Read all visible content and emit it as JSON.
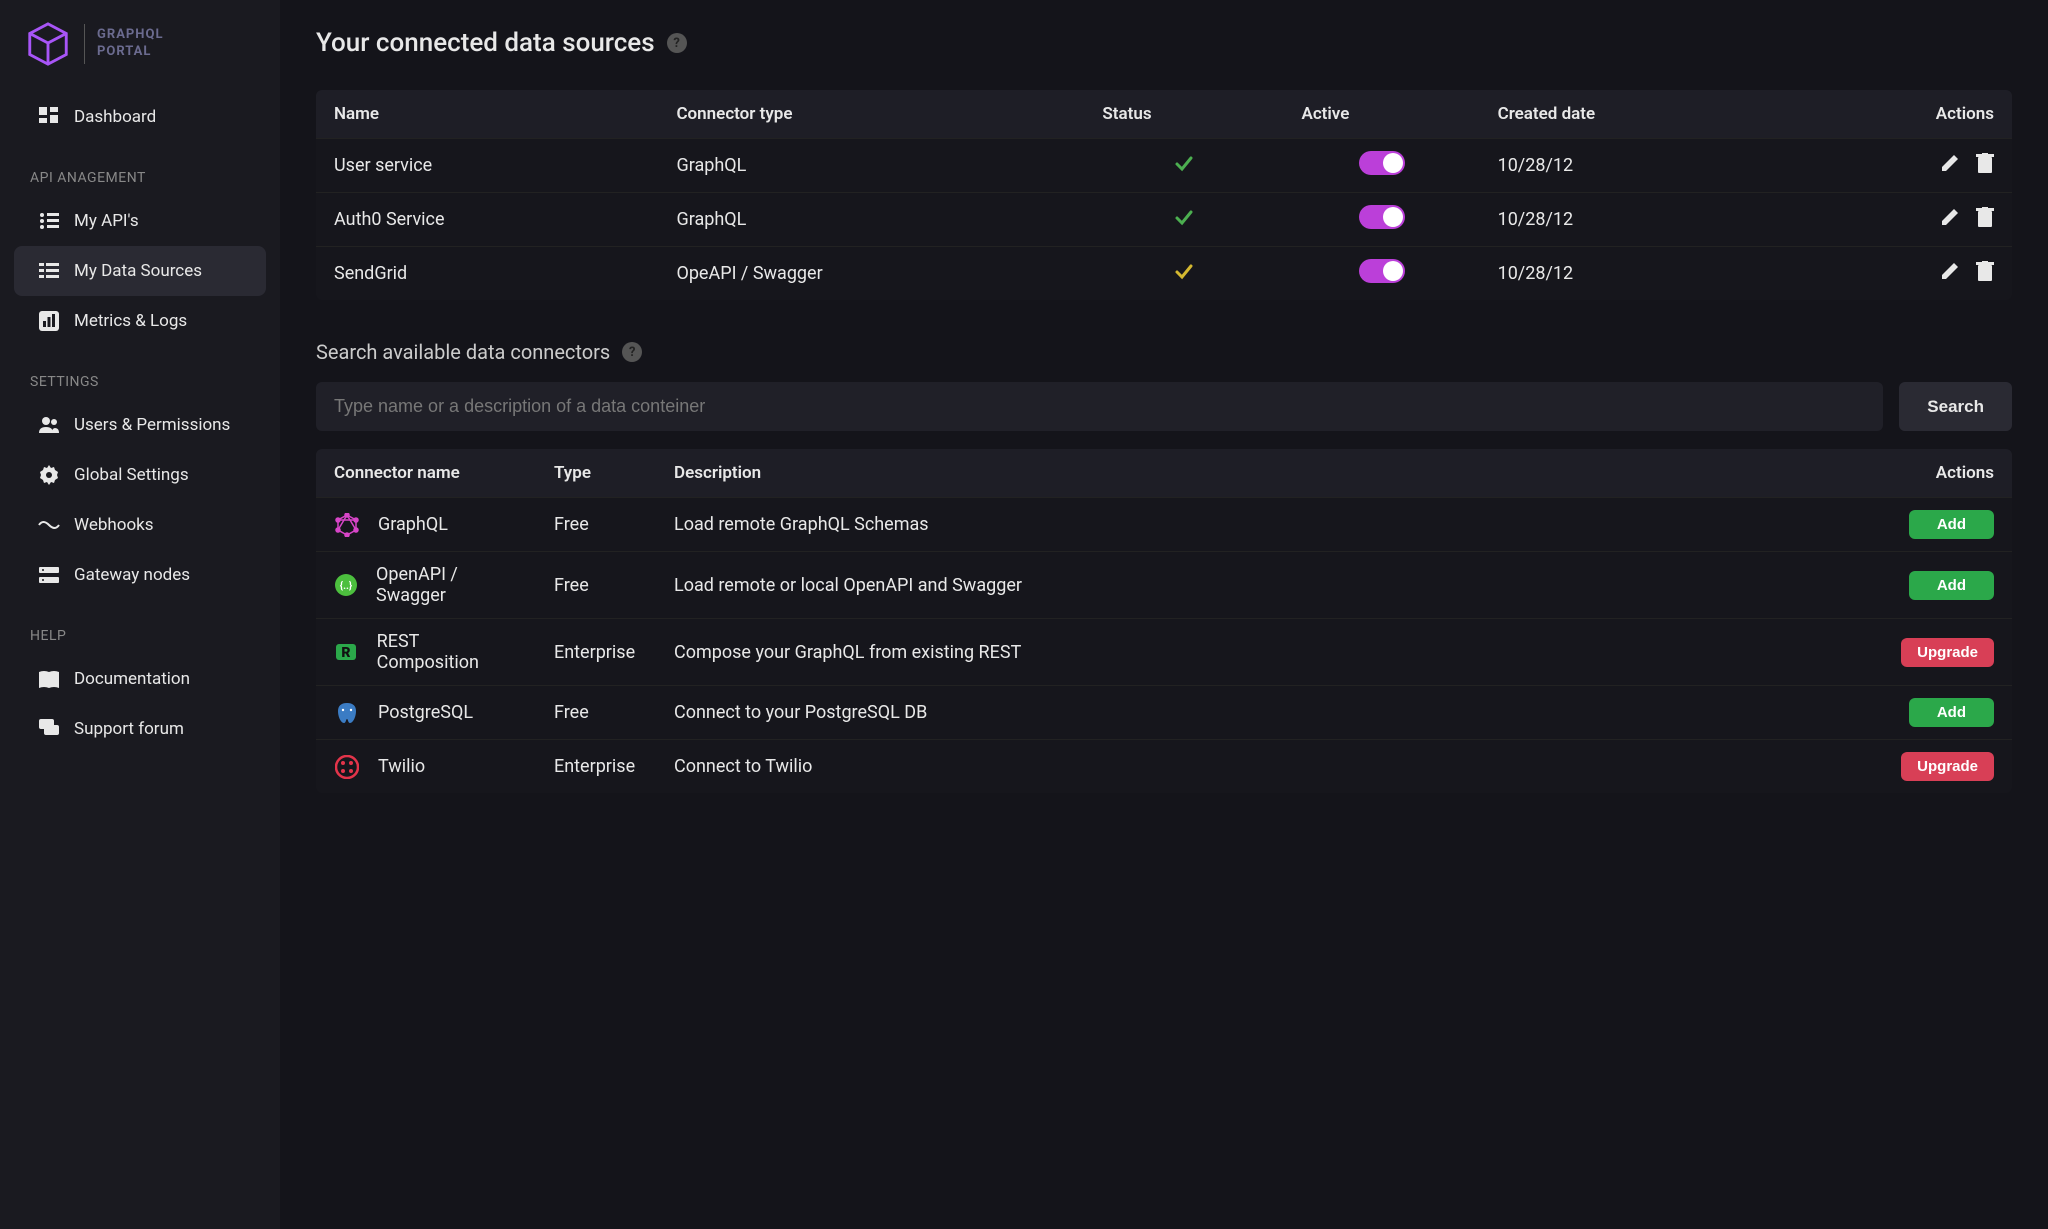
{
  "brand": {
    "line1": "GRAPHQL",
    "line2": "PORTAL"
  },
  "nav": {
    "dashboard": "Dashboard",
    "section_api": "API ANAGEMENT",
    "my_apis": "My API's",
    "my_data_sources": "My Data Sources",
    "metrics_logs": "Metrics & Logs",
    "section_settings": "SETTINGS",
    "users_permissions": "Users & Permissions",
    "global_settings": "Global Settings",
    "webhooks": "Webhooks",
    "gateway_nodes": "Gateway nodes",
    "section_help": "HELP",
    "documentation": "Documentation",
    "support_forum": "Support forum"
  },
  "page_title": "Your connected data sources",
  "connected_table": {
    "headers": {
      "name": "Name",
      "connector_type": "Connector type",
      "status": "Status",
      "active": "Active",
      "created": "Created date",
      "actions": "Actions"
    },
    "rows": [
      {
        "name": "User service",
        "connector_type": "GraphQL",
        "status": "green",
        "active": true,
        "created": "10/28/12"
      },
      {
        "name": "Auth0 Service",
        "connector_type": "GraphQL",
        "status": "green",
        "active": true,
        "created": "10/28/12"
      },
      {
        "name": "SendGrid",
        "connector_type": "OpeAPI / Swagger",
        "status": "yellow",
        "active": true,
        "created": "10/28/12"
      }
    ]
  },
  "search_section_title": "Search available data connectors",
  "search": {
    "placeholder": "Type name or a description of a data conteiner",
    "button": "Search"
  },
  "connectors_table": {
    "headers": {
      "name": "Connector name",
      "type": "Type",
      "description": "Description",
      "actions": "Actions"
    },
    "rows": [
      {
        "name": "GraphQL",
        "type": "Free",
        "description": "Load remote GraphQL Schemas",
        "action": "Add",
        "icon": "graphql",
        "color": "#d845c8"
      },
      {
        "name": "OpenAPI / Swagger",
        "type": "Free",
        "description": "Load remote or local OpenAPI and Swagger",
        "action": "Add",
        "icon": "openapi",
        "color": "#4cbf3e"
      },
      {
        "name": "REST Composition",
        "type": "Enterprise",
        "description": "Compose your GraphQL from existing REST",
        "action": "Upgrade",
        "icon": "rest",
        "color": "#2ba84a"
      },
      {
        "name": "PostgreSQL",
        "type": "Free",
        "description": "Connect to your PostgreSQL DB",
        "action": "Add",
        "icon": "postgres",
        "color": "#3b7cc4"
      },
      {
        "name": "Twilio",
        "type": "Enterprise",
        "description": "Connect to Twilio",
        "action": "Upgrade",
        "icon": "twilio",
        "color": "#e3344a"
      }
    ]
  }
}
